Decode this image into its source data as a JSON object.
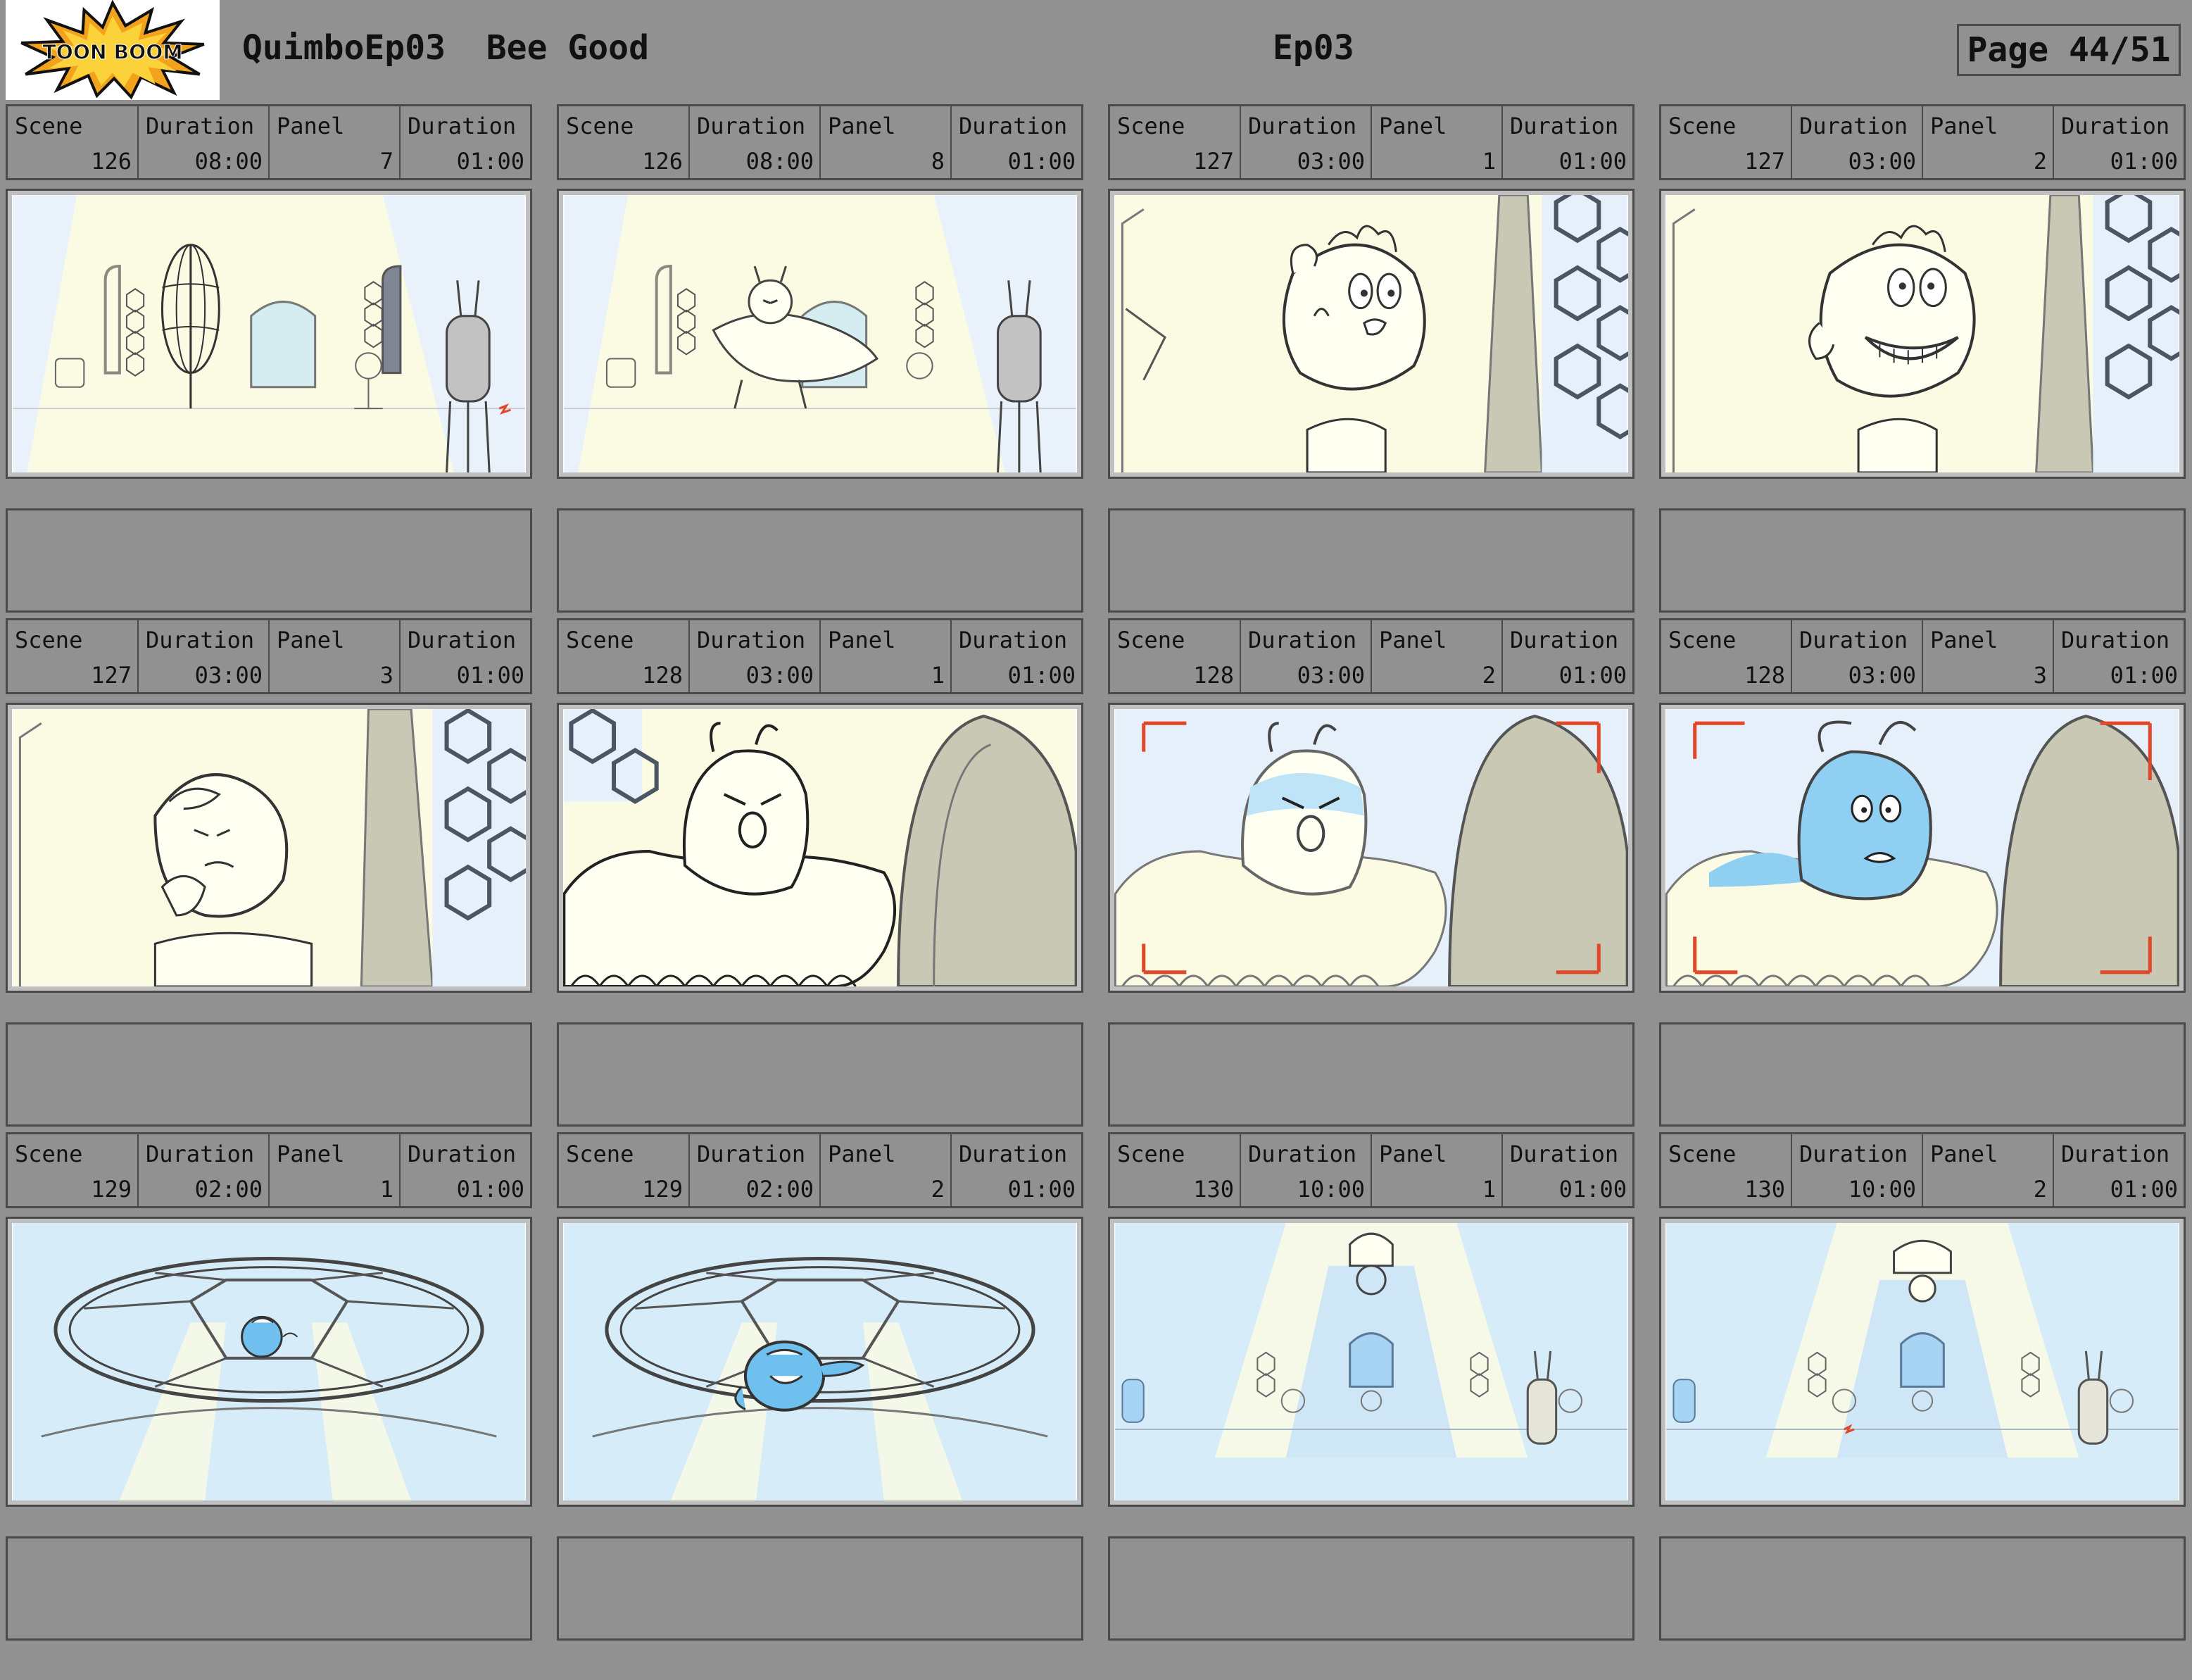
{
  "header": {
    "logo_text": "TOON BOOM",
    "show_title": "QuimboEp03  Bee Good",
    "episode": "Ep03",
    "page": "Page 44/51"
  },
  "labels": {
    "scene": "Scene",
    "duration": "Duration",
    "panel": "Panel"
  },
  "panels": [
    {
      "scene": "126",
      "scene_duration": "08:00",
      "panel": "7",
      "panel_duration": "01:00",
      "image": "wide-hall-cage"
    },
    {
      "scene": "126",
      "scene_duration": "08:00",
      "panel": "8",
      "panel_duration": "01:00",
      "image": "wide-hall-bee-queen"
    },
    {
      "scene": "127",
      "scene_duration": "03:00",
      "panel": "1",
      "panel_duration": "01:00",
      "image": "kid-worried"
    },
    {
      "scene": "127",
      "scene_duration": "03:00",
      "panel": "2",
      "panel_duration": "01:00",
      "image": "kid-grin"
    },
    {
      "scene": "127",
      "scene_duration": "03:00",
      "panel": "3",
      "panel_duration": "01:00",
      "image": "kid-thinking"
    },
    {
      "scene": "128",
      "scene_duration": "03:00",
      "panel": "1",
      "panel_duration": "01:00",
      "image": "queen-angry"
    },
    {
      "scene": "128",
      "scene_duration": "03:00",
      "panel": "2",
      "panel_duration": "01:00",
      "image": "queen-angry-blue"
    },
    {
      "scene": "128",
      "scene_duration": "03:00",
      "panel": "3",
      "panel_duration": "01:00",
      "image": "queen-scared-blue"
    },
    {
      "scene": "129",
      "scene_duration": "02:00",
      "panel": "1",
      "panel_duration": "01:00",
      "image": "ceiling-bee-small"
    },
    {
      "scene": "129",
      "scene_duration": "02:00",
      "panel": "2",
      "panel_duration": "01:00",
      "image": "ceiling-bee-large"
    },
    {
      "scene": "130",
      "scene_duration": "10:00",
      "panel": "1",
      "panel_duration": "01:00",
      "image": "hall-blue-lights"
    },
    {
      "scene": "130",
      "scene_duration": "10:00",
      "panel": "2",
      "panel_duration": "01:00",
      "image": "hall-blue-lights-2"
    }
  ],
  "colors": {
    "background": "#919191",
    "border": "#4a4a4a",
    "cream": "#fbfbe4",
    "sky": "#d6ecf8",
    "bee_blue": "#8fd0f2",
    "mark_red": "#e0482a"
  }
}
